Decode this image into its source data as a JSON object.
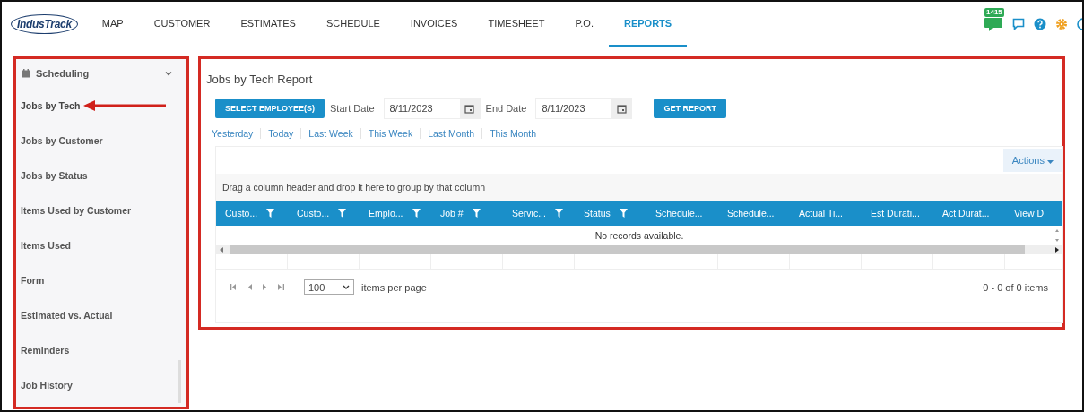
{
  "logo": {
    "text": "IndusTrack"
  },
  "nav": [
    {
      "label": "MAP",
      "selected": false
    },
    {
      "label": "CUSTOMER",
      "selected": false
    },
    {
      "label": "ESTIMATES",
      "selected": false
    },
    {
      "label": "SCHEDULE",
      "selected": false
    },
    {
      "label": "INVOICES",
      "selected": false
    },
    {
      "label": "TIMESHEET",
      "selected": false
    },
    {
      "label": "P.O.",
      "selected": false
    },
    {
      "label": "REPORTS",
      "selected": true
    }
  ],
  "notifications": {
    "badge": "1415"
  },
  "sidebar": {
    "group": "Scheduling",
    "expanded": true,
    "items": [
      {
        "label": "Jobs by Tech",
        "selected": true
      },
      {
        "label": "Jobs by Customer",
        "selected": false
      },
      {
        "label": "Jobs by Status",
        "selected": false
      },
      {
        "label": "Items Used by Customer",
        "selected": false
      },
      {
        "label": "Items Used",
        "selected": false
      },
      {
        "label": "Form",
        "selected": false
      },
      {
        "label": "Estimated vs. Actual",
        "selected": false
      },
      {
        "label": "Reminders",
        "selected": false
      },
      {
        "label": "Job History",
        "selected": false
      }
    ]
  },
  "report": {
    "title": "Jobs by Tech Report",
    "select_button": "SELECT EMPLOYEE(S)",
    "start_label": "Start Date",
    "start_value": "8/11/2023",
    "end_label": "End Date",
    "end_value": "8/11/2023",
    "get_button": "GET REPORT",
    "quick_ranges": [
      "Yesterday",
      "Today",
      "Last Week",
      "This Week",
      "Last Month",
      "This Month"
    ],
    "actions": "Actions",
    "group_hint": "Drag a column header and drop it here to group by that column",
    "columns": [
      {
        "label": "Custo...",
        "filter": true
      },
      {
        "label": "Custo...",
        "filter": true
      },
      {
        "label": "Emplo...",
        "filter": true
      },
      {
        "label": "Job #",
        "filter": true
      },
      {
        "label": "Servic...",
        "filter": true
      },
      {
        "label": "Status",
        "filter": true
      },
      {
        "label": "Schedule...",
        "filter": false
      },
      {
        "label": "Schedule...",
        "filter": false
      },
      {
        "label": "Actual Ti...",
        "filter": false
      },
      {
        "label": "Est Durati...",
        "filter": false
      },
      {
        "label": "Act Durat...",
        "filter": false
      },
      {
        "label": "View D",
        "filter": false
      }
    ],
    "empty": "No records available.",
    "page_size": "100",
    "per_page_label": "items per page",
    "count": "0 - 0 of 0 items"
  }
}
